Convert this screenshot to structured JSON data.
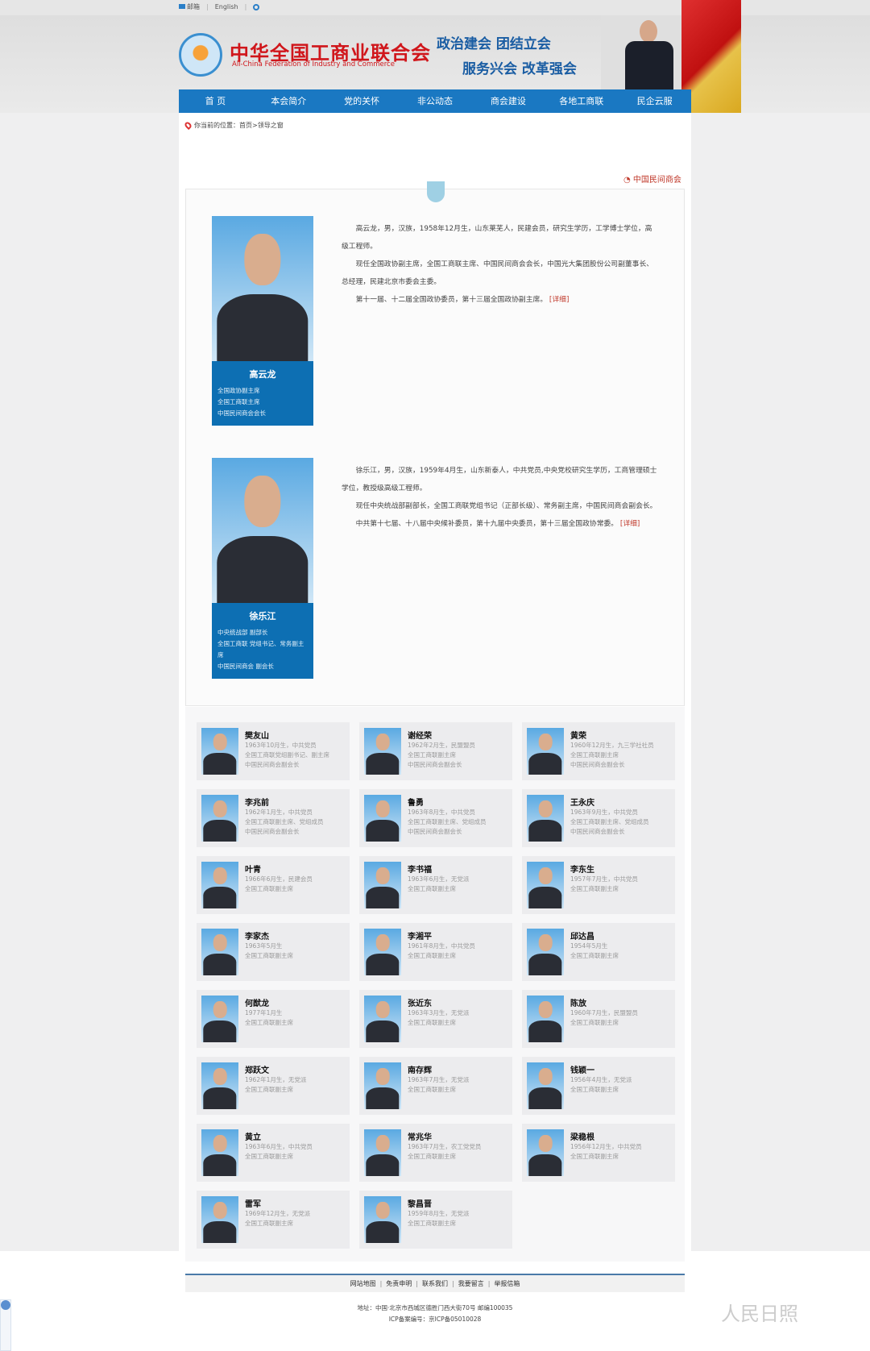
{
  "topbar": {
    "mail": "邮箱",
    "english": "English"
  },
  "header": {
    "title_cn": "中华全国工商业联合会",
    "title_en": "All-China Federation of Industry and Commerce",
    "slogan1": "政治建会  团结立会",
    "slogan2": "服务兴会  改革强会"
  },
  "nav": [
    "首 页",
    "本会简介",
    "党的关怀",
    "非公动态",
    "商会建设",
    "各地工商联",
    "民企云服"
  ],
  "breadcrumb": "你当前的位置：首页>领导之窗",
  "side_link": "中国民间商会",
  "leaders": [
    {
      "name": "高云龙",
      "roles": [
        "全国政协副主席",
        "全国工商联主席",
        "中国民间商会会长"
      ],
      "bio": [
        "高云龙，男，汉族，1958年12月生，山东莱芜人，民建会员，研究生学历，工学博士学位，高级工程师。",
        "现任全国政协副主席，全国工商联主席、中国民间商会会长，中国光大集团股份公司副董事长、总经理，民建北京市委会主委。",
        "第十一届、十二届全国政协委员，第十三届全国政协副主席。"
      ],
      "more": "[详细]"
    },
    {
      "name": "徐乐江",
      "roles": [
        "中央统战部 副部长",
        "全国工商联 党组书记、常务副主席",
        "中国民间商会 副会长"
      ],
      "bio": [
        "徐乐江，男，汉族，1959年4月生，山东新泰人，中共党员,中央党校研究生学历，工商管理硕士学位，教授级高级工程师。",
        "现任中央统战部副部长，全国工商联党组书记（正部长级）、常务副主席，中国民间商会副会长。",
        "中共第十七届、十八届中央候补委员，第十九届中央委员，第十三届全国政协常委。"
      ],
      "more": "[详细]"
    }
  ],
  "members": [
    {
      "name": "樊友山",
      "lines": [
        "1963年10月生，中共党员",
        "全国工商联党组副书记、副主席",
        "中国民间商会副会长"
      ]
    },
    {
      "name": "谢经荣",
      "lines": [
        "1962年2月生，民盟盟员",
        "全国工商联副主席",
        "中国民间商会副会长"
      ]
    },
    {
      "name": "黄荣",
      "lines": [
        "1960年12月生，九三学社社员",
        "全国工商联副主席",
        "中国民间商会副会长"
      ]
    },
    {
      "name": "李兆前",
      "lines": [
        "1962年1月生，中共党员",
        "全国工商联副主席、党组成员",
        "中国民间商会副会长"
      ]
    },
    {
      "name": "鲁勇",
      "lines": [
        "1963年8月生，中共党员",
        "全国工商联副主席、党组成员",
        "中国民间商会副会长"
      ]
    },
    {
      "name": "王永庆",
      "lines": [
        "1963年9月生，中共党员",
        "全国工商联副主席、党组成员",
        "中国民间商会副会长"
      ]
    },
    {
      "name": "叶青",
      "lines": [
        "1966年6月生，民建会员",
        "全国工商联副主席"
      ]
    },
    {
      "name": "李书福",
      "lines": [
        "1963年6月生，无党派",
        "全国工商联副主席"
      ]
    },
    {
      "name": "李东生",
      "lines": [
        "1957年7月生，中共党员",
        "全国工商联副主席"
      ]
    },
    {
      "name": "李家杰",
      "lines": [
        "1963年5月生",
        "全国工商联副主席"
      ]
    },
    {
      "name": "李湘平",
      "lines": [
        "1961年8月生，中共党员",
        "全国工商联副主席"
      ]
    },
    {
      "name": "邱达昌",
      "lines": [
        "1954年5月生",
        "全国工商联副主席"
      ]
    },
    {
      "name": "何猷龙",
      "lines": [
        "1977年1月生",
        "全国工商联副主席"
      ]
    },
    {
      "name": "张近东",
      "lines": [
        "1963年3月生，无党派",
        "全国工商联副主席"
      ]
    },
    {
      "name": "陈放",
      "lines": [
        "1960年7月生，民盟盟员",
        "全国工商联副主席"
      ]
    },
    {
      "name": "郑跃文",
      "lines": [
        "1962年1月生，无党派",
        "全国工商联副主席"
      ]
    },
    {
      "name": "南存辉",
      "lines": [
        "1963年7月生，无党派",
        "全国工商联副主席"
      ]
    },
    {
      "name": "钱颖一",
      "lines": [
        "1956年4月生，无党派",
        "全国工商联副主席"
      ]
    },
    {
      "name": "黄立",
      "lines": [
        "1963年6月生，中共党员",
        "全国工商联副主席"
      ]
    },
    {
      "name": "常兆华",
      "lines": [
        "1963年7月生，农工党党员",
        "全国工商联副主席"
      ]
    },
    {
      "name": "梁稳根",
      "lines": [
        "1956年12月生，中共党员",
        "全国工商联副主席"
      ]
    },
    {
      "name": "雷军",
      "lines": [
        "1969年12月生，无党派",
        "全国工商联副主席"
      ]
    },
    {
      "name": "黎昌晋",
      "lines": [
        "1959年8月生，无党派",
        "全国工商联副主席"
      ]
    }
  ],
  "footer": {
    "links": [
      "网站地图",
      "免责申明",
      "联系我们",
      "我要留言",
      "举报信箱"
    ],
    "address": "地址：中国·北京市西城区德胜门西大街70号 邮编100035",
    "icp": "ICP备案编号：京ICP备05010028"
  },
  "watermark": "人民日照"
}
